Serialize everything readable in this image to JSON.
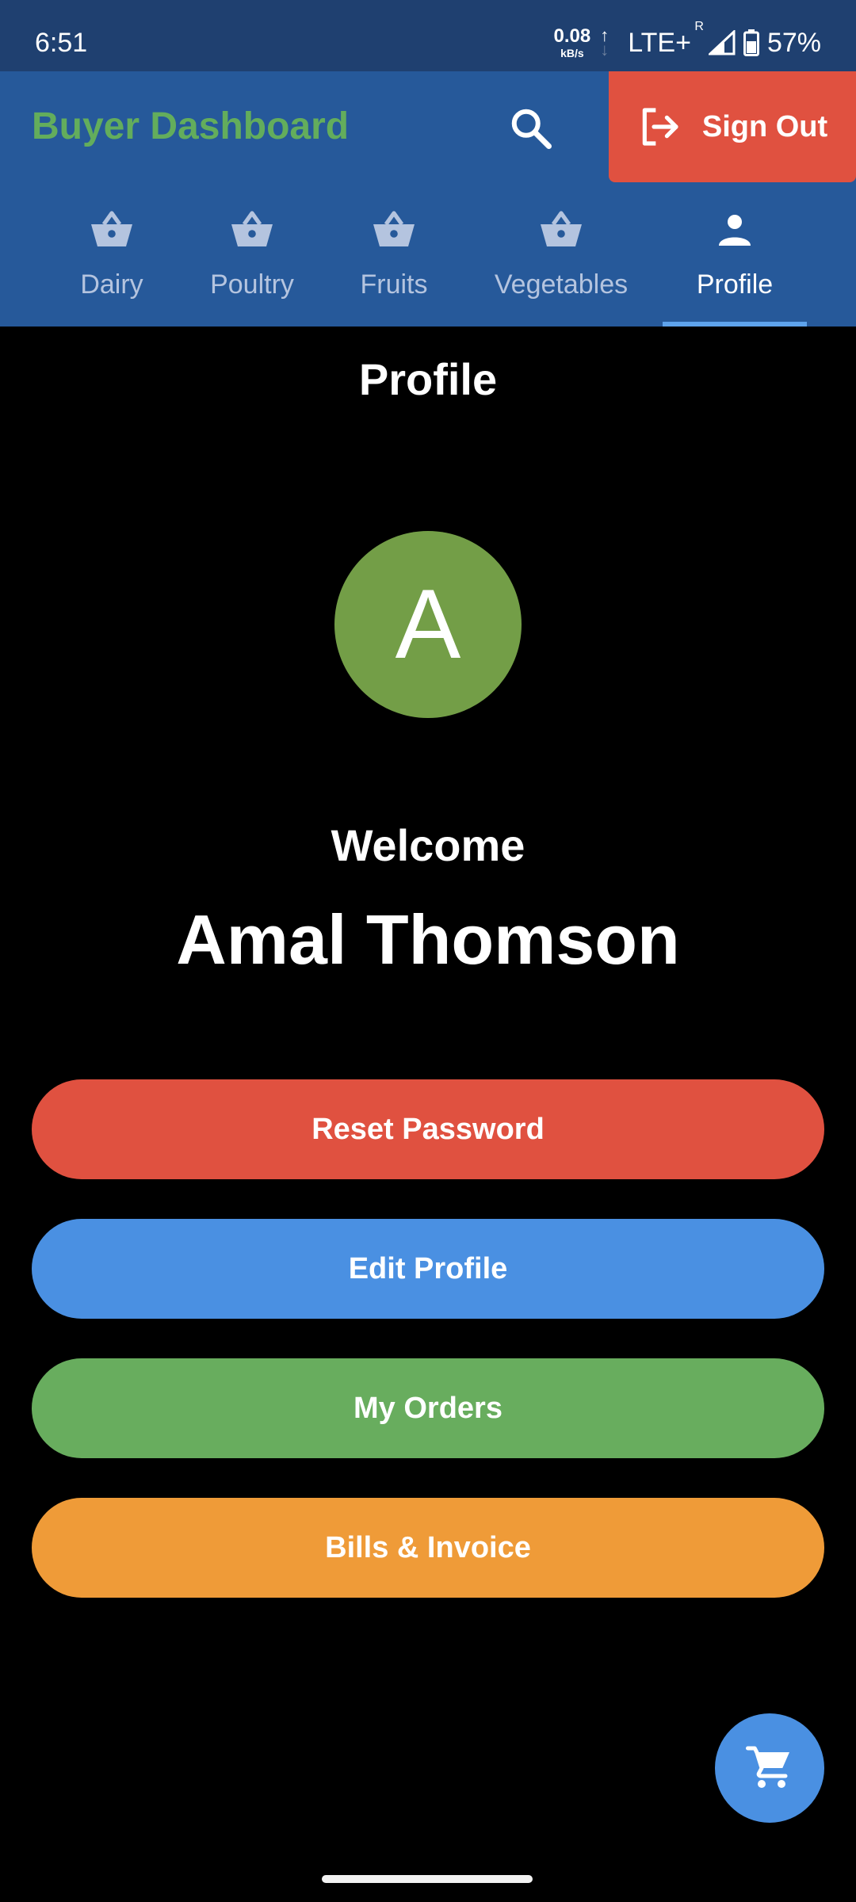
{
  "status_bar": {
    "time": "6:51",
    "net_speed_value": "0.08",
    "net_speed_unit": "kB/s",
    "network": "LTE+",
    "roaming": "R",
    "battery": "57%"
  },
  "app_bar": {
    "title": "Buyer Dashboard",
    "title_color": "#63ad5c",
    "background_color": "#26599a",
    "search_icon": "search-icon",
    "sign_out_label": "Sign Out",
    "sign_out_icon": "logout-icon",
    "sign_out_color": "#e05140"
  },
  "tabs": [
    {
      "label": "Dairy",
      "icon": "basket-icon",
      "active": false
    },
    {
      "label": "Poultry",
      "icon": "basket-icon",
      "active": false
    },
    {
      "label": "Fruits",
      "icon": "basket-icon",
      "active": false
    },
    {
      "label": "Vegetables",
      "icon": "basket-icon",
      "active": false
    },
    {
      "label": "Profile",
      "icon": "person-icon",
      "active": true
    }
  ],
  "profile": {
    "title": "Profile",
    "avatar_letter": "A",
    "avatar_color": "#739e47",
    "welcome": "Welcome",
    "name": "Amal Thomson"
  },
  "actions": [
    {
      "label": "Reset Password",
      "color": "#e05140"
    },
    {
      "label": "Edit Profile",
      "color": "#4a90e2"
    },
    {
      "label": "My Orders",
      "color": "#68ad5e"
    },
    {
      "label": "Bills & Invoice",
      "color": "#ef9b38"
    }
  ],
  "fab": {
    "icon": "cart-icon",
    "color": "#4a90e2"
  }
}
